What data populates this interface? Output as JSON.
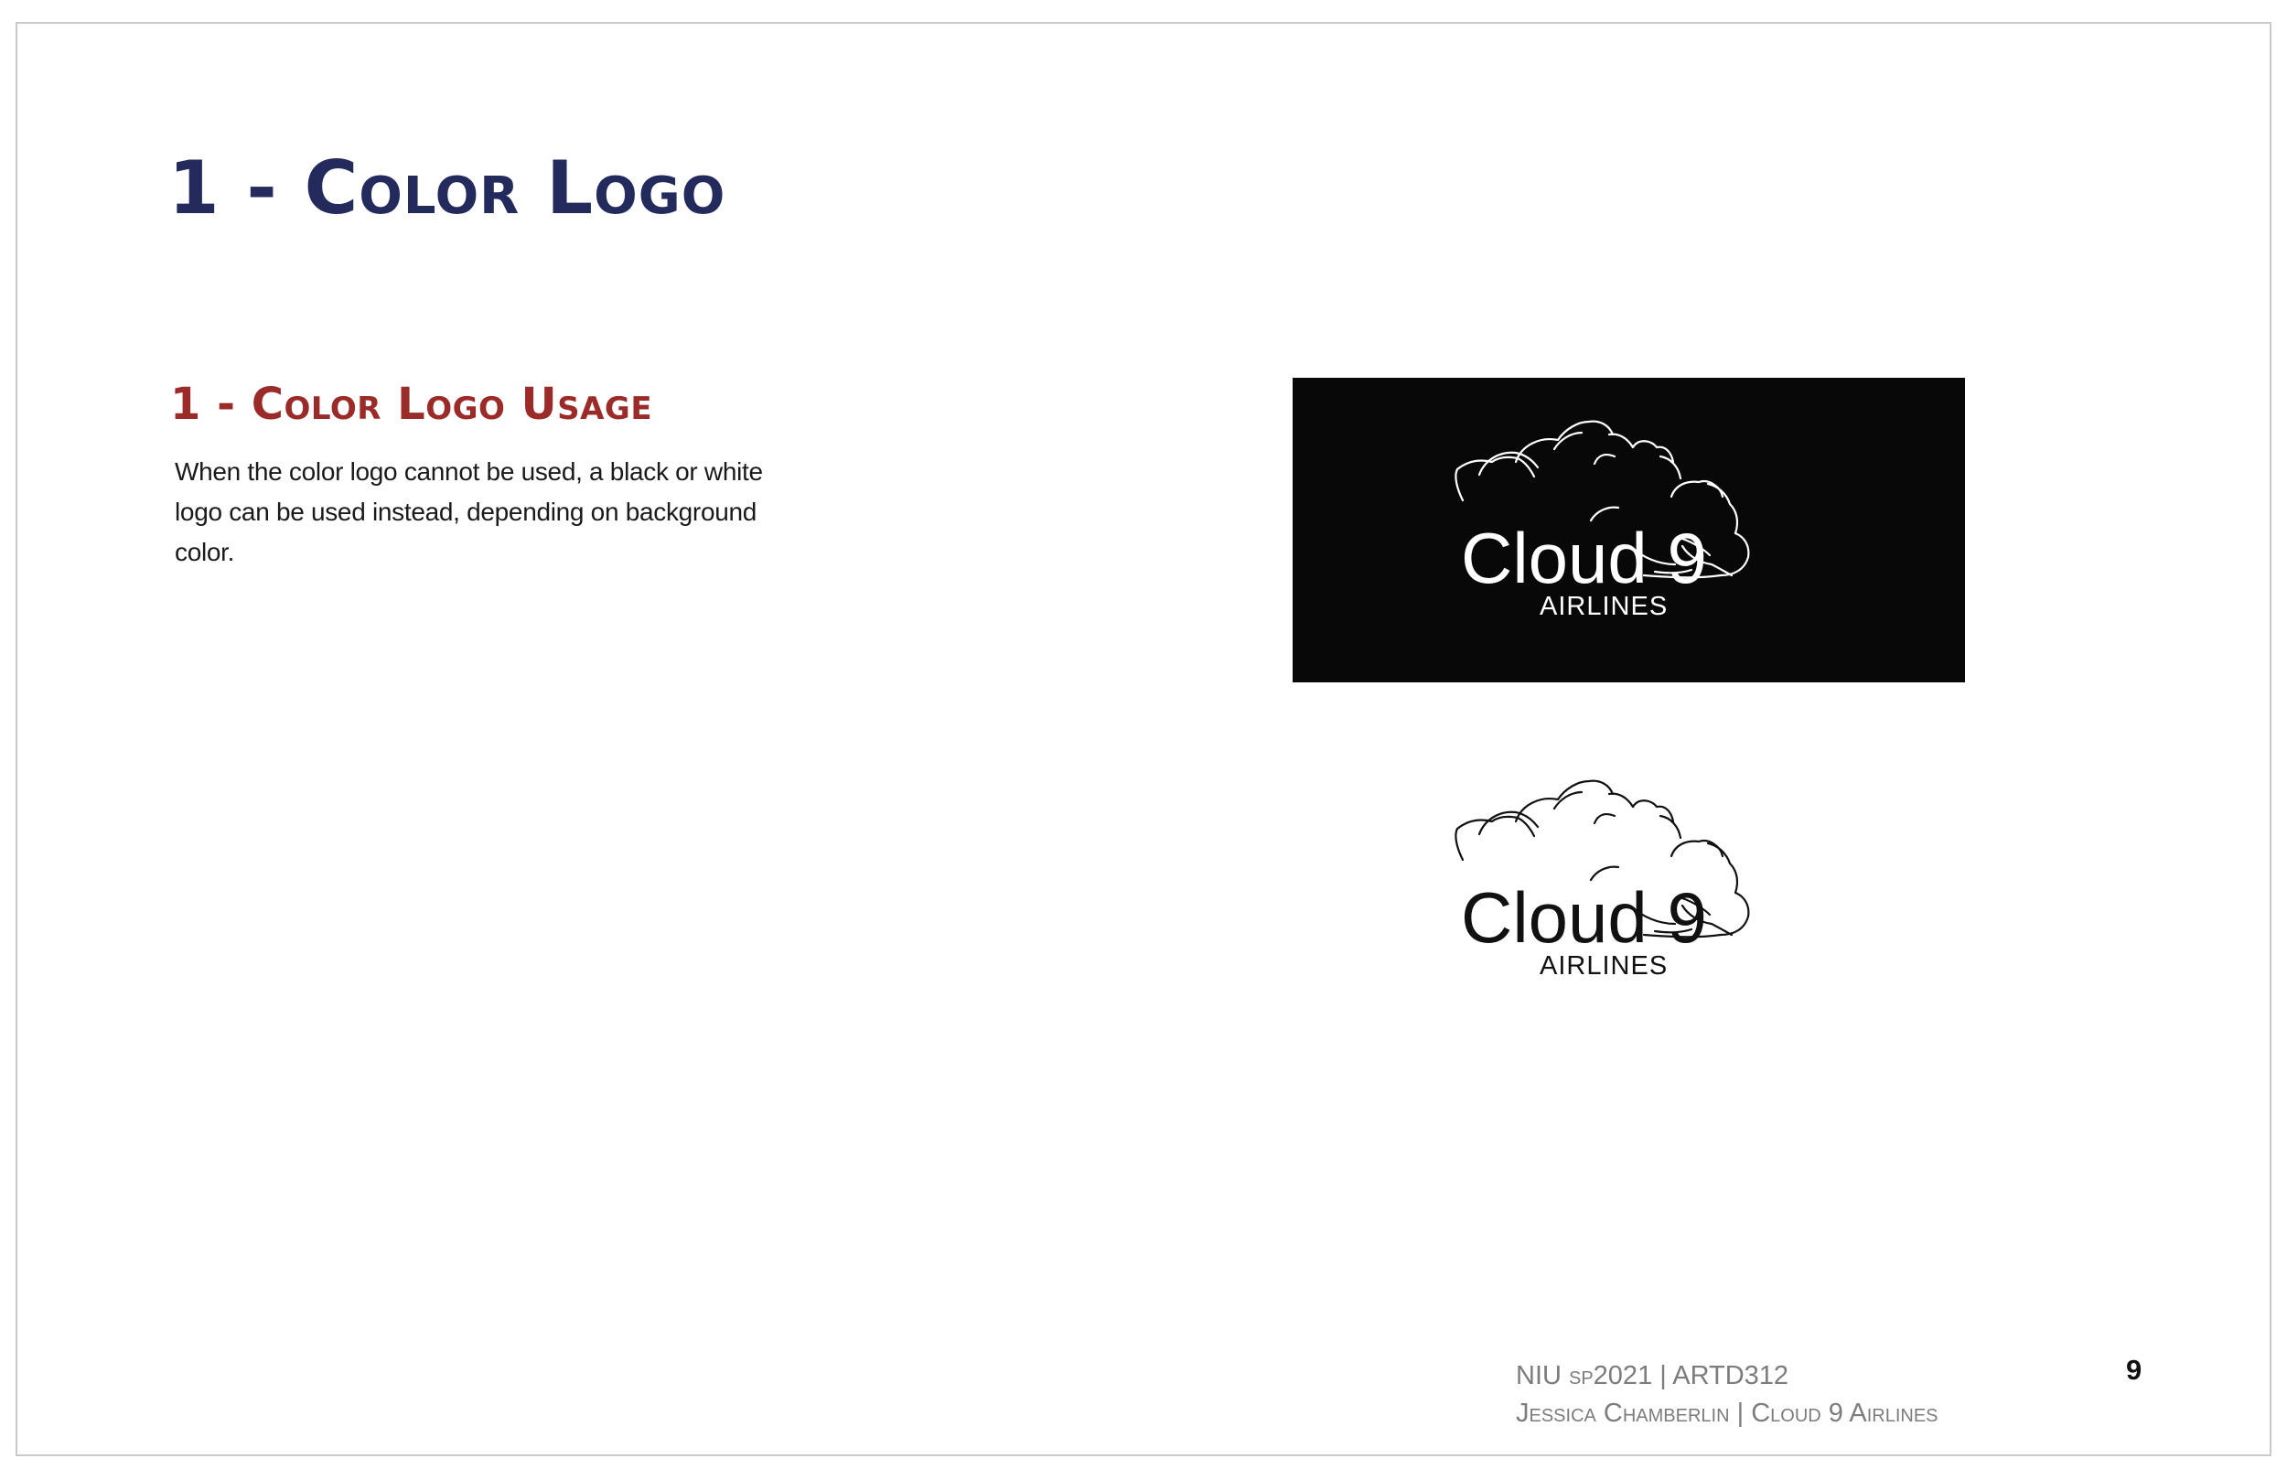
{
  "page": {
    "title": "1 - Color Logo",
    "section_heading": "1 - Color Logo Usage",
    "body": "When the color logo cannot be used, a black or white logo can be used instead, depending on background color."
  },
  "logos": {
    "black_background": {
      "brand_name": "Cloud 9",
      "sub_name": "AIRLINES",
      "background_color": "#080808",
      "mark_color": "#ffffff",
      "icon": "cloud-icon"
    },
    "white_background": {
      "brand_name": "Cloud 9",
      "sub_name": "AIRLINES",
      "background_color": "#ffffff",
      "mark_color": "#111111",
      "icon": "cloud-icon"
    }
  },
  "footer": {
    "course_line": "NIU sp2021 | ARTD312",
    "author_line": "Jessica Chamberlin | Cloud 9 Airlines",
    "page_number": "9"
  },
  "colors": {
    "title": "#232a5c",
    "section_heading": "#9a2b28",
    "footer_text": "#7c7c7c"
  }
}
